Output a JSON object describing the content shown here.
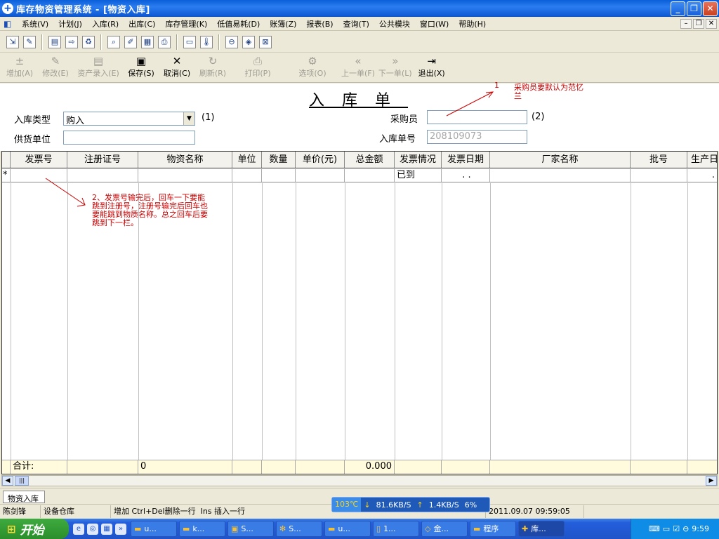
{
  "titlebar": {
    "title": "库存物资管理系统 - [物资入库]",
    "minimize": "_",
    "restore": "❐",
    "close": "✕"
  },
  "menu": {
    "items": [
      "系统(V)",
      "计划(J)",
      "入库(R)",
      "出库(C)",
      "库存管理(K)",
      "低值易耗(D)",
      "账簿(Z)",
      "报表(B)",
      "查询(T)",
      "公共模块",
      "窗口(W)",
      "帮助(H)"
    ],
    "mdi_min": "–",
    "mdi_restore": "❐",
    "mdi_close": "✕"
  },
  "actions": [
    {
      "label": "增加(A)",
      "icon": "±",
      "enabled": false
    },
    {
      "label": "修改(E)",
      "icon": "✎",
      "enabled": false
    },
    {
      "label": "资产录入(E)",
      "icon": "▤",
      "enabled": false
    },
    {
      "label": "保存(S)",
      "icon": "▣",
      "enabled": true
    },
    {
      "label": "取消(C)",
      "icon": "✕",
      "enabled": true
    },
    {
      "label": "刷新(R)",
      "icon": "↻",
      "enabled": false
    },
    {
      "label": "打印(P)",
      "icon": "⎙",
      "enabled": false
    },
    {
      "label": "选项(O)",
      "icon": "⚙",
      "enabled": false
    },
    {
      "label": "上一单(F)",
      "icon": "«",
      "enabled": false
    },
    {
      "label": "下一单(L)",
      "icon": "»",
      "enabled": false
    },
    {
      "label": "退出(X)",
      "icon": "⇥",
      "enabled": true
    }
  ],
  "form": {
    "doc_title": "入库单",
    "type_label": "入库类型",
    "type_value": "购入",
    "type_marker": "(1)",
    "supplier_label": "供货单位",
    "supplier_value": "",
    "buyer_label": "采购员",
    "buyer_value": "",
    "buyer_marker": "(2)",
    "docno_label": "入库单号",
    "docno_value": "208109073"
  },
  "notes": {
    "note1_num": "1",
    "note1_text": "采购员要默认为范忆兰",
    "note2_text": "2、发票号输完后，回车一下要能跳到注册号，注册号输完后回车也要能跳到物质名称。总之回车后要跳到下一栏。"
  },
  "grid": {
    "columns": [
      "发票号",
      "注册证号",
      "物资名称",
      "单位",
      "数量",
      "单价(元)",
      "总金额",
      "发票情况",
      "发票日期",
      "厂家名称",
      "批号",
      "生产日"
    ],
    "row_marker": "*",
    "row_invoice_status": "已到",
    "row_invoice_date": ". .",
    "row_last": ".",
    "sum_label": "合计:",
    "sum_name_value": "0",
    "sum_total": "0.000"
  },
  "mdi_tab": "物资入库",
  "status": {
    "user": "陈剑锋",
    "warehouse": "设备仓库",
    "hint": "增加 Ctrl+Del删除一行  Ins 插入一行",
    "datetime": "2011.09.07 09:59:05"
  },
  "netmon": {
    "temp": "103℃",
    "down": "81.6KB/S",
    "up": "1.4KB/S",
    "cpu": "6%"
  },
  "taskbar": {
    "start": "开始",
    "tasks": [
      "u...",
      "k...",
      "S...",
      "S...",
      "u...",
      "1...",
      "金...",
      "程序",
      "库..."
    ],
    "clock": "9:59"
  }
}
